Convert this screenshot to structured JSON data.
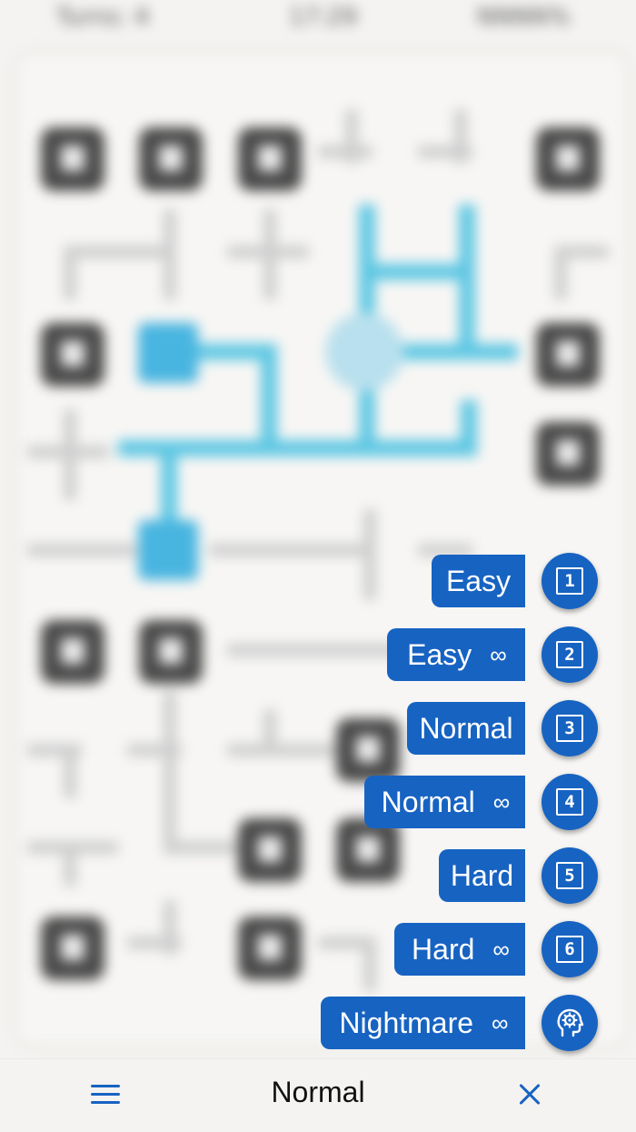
{
  "status_bar": {
    "turns_text": "Turns: 4",
    "time_text": "17:29",
    "score_text": "NNNN%"
  },
  "game": {
    "current_difficulty": "Normal"
  },
  "difficulty_menu": {
    "items": [
      {
        "label": "Easy",
        "infinite": false,
        "number": "1",
        "infinity_symbol": ""
      },
      {
        "label": "Easy",
        "infinite": true,
        "number": "2",
        "infinity_symbol": "∞"
      },
      {
        "label": "Normal",
        "infinite": false,
        "number": "3",
        "infinity_symbol": ""
      },
      {
        "label": "Normal",
        "infinite": true,
        "number": "4",
        "infinity_symbol": "∞"
      },
      {
        "label": "Hard",
        "infinite": false,
        "number": "5",
        "infinity_symbol": ""
      },
      {
        "label": "Hard",
        "infinite": true,
        "number": "6",
        "infinity_symbol": "∞"
      },
      {
        "label": "Nightmare",
        "infinite": true,
        "icon": "head-gear-icon",
        "infinity_symbol": "∞"
      }
    ]
  },
  "bottom_bar": {
    "menu_icon": "hamburger-menu-icon",
    "title": "Normal",
    "close_icon": "close-icon"
  },
  "colors": {
    "accent": "#1763c2",
    "pipe_active": "#5ec7e3",
    "background": "#f4f3f1"
  }
}
